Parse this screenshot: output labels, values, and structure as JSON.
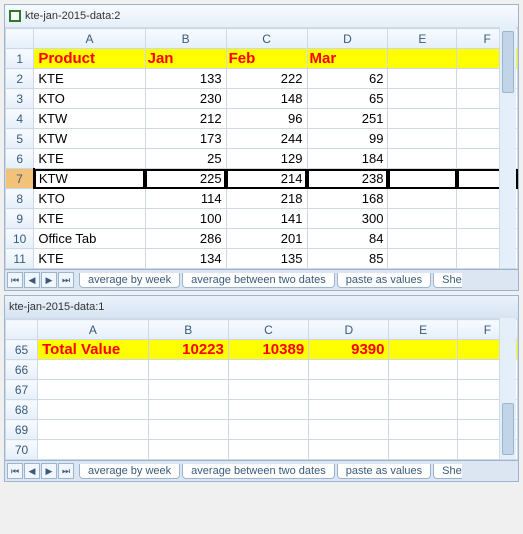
{
  "pane_top": {
    "title": "kte-jan-2015-data:2",
    "col_letters": [
      "A",
      "B",
      "C",
      "D",
      "E",
      "F"
    ],
    "row_numbers": [
      1,
      2,
      3,
      4,
      5,
      6,
      7,
      8,
      9,
      10,
      11
    ],
    "header_row": {
      "product": "Product",
      "jan": "Jan",
      "feb": "Feb",
      "mar": "Mar"
    },
    "selected_row_index": 6,
    "rows": [
      {
        "product": "KTE",
        "jan": 133,
        "feb": 222,
        "mar": 62
      },
      {
        "product": "KTO",
        "jan": 230,
        "feb": 148,
        "mar": 65
      },
      {
        "product": "KTW",
        "jan": 212,
        "feb": 96,
        "mar": 251
      },
      {
        "product": "KTW",
        "jan": 173,
        "feb": 244,
        "mar": 99
      },
      {
        "product": "KTE",
        "jan": 25,
        "feb": 129,
        "mar": 184
      },
      {
        "product": "KTW",
        "jan": 225,
        "feb": 214,
        "mar": 238
      },
      {
        "product": "KTO",
        "jan": 114,
        "feb": 218,
        "mar": 168
      },
      {
        "product": "KTE",
        "jan": 100,
        "feb": 141,
        "mar": 300
      },
      {
        "product": "Office Tab",
        "jan": 286,
        "feb": 201,
        "mar": 84
      },
      {
        "product": "KTE",
        "jan": 134,
        "feb": 135,
        "mar": 85
      }
    ],
    "tabs": [
      "average by week",
      "average between two dates",
      "paste as values",
      "She"
    ]
  },
  "pane_bottom": {
    "title": "kte-jan-2015-data:1",
    "col_letters": [
      "A",
      "B",
      "C",
      "D",
      "E",
      "F"
    ],
    "row_numbers": [
      65,
      66,
      67,
      68,
      69,
      70
    ],
    "total_row": {
      "label": "Total Value",
      "jan": 10223,
      "feb": 10389,
      "mar": 9390
    },
    "tabs": [
      "average by week",
      "average between two dates",
      "paste as values",
      "She"
    ]
  },
  "nav_glyphs": {
    "first": "⏮",
    "prev": "◀",
    "next": "▶",
    "last": "⏭"
  }
}
